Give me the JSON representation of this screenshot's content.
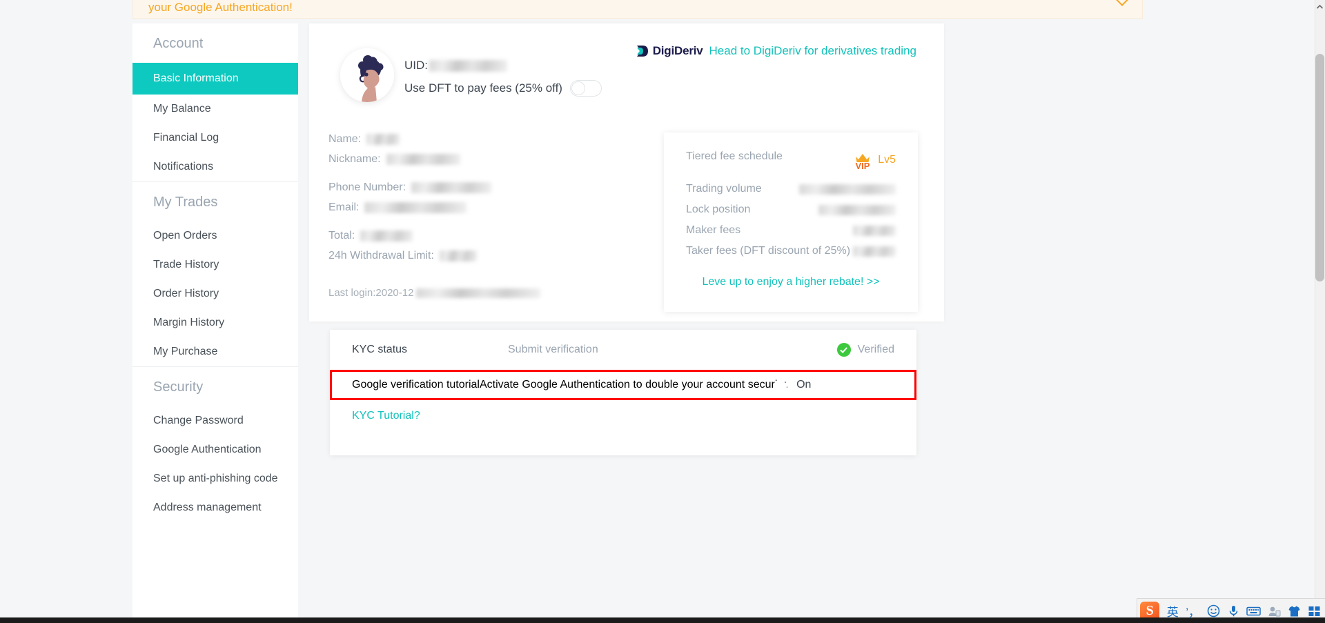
{
  "banner": {
    "text": "your Google Authentication!",
    "chevron_icon": "chevron-down-icon"
  },
  "sidebar": {
    "groups": [
      {
        "title": "Account",
        "items": [
          {
            "label": "Basic Information",
            "active": true
          },
          {
            "label": "My Balance",
            "active": false
          },
          {
            "label": "Financial Log",
            "active": false
          },
          {
            "label": "Notifications",
            "active": false
          }
        ]
      },
      {
        "title": "My Trades",
        "items": [
          {
            "label": "Open Orders",
            "active": false
          },
          {
            "label": "Trade History",
            "active": false
          },
          {
            "label": "Order History",
            "active": false
          },
          {
            "label": "Margin History",
            "active": false
          },
          {
            "label": "My Purchase",
            "active": false
          }
        ]
      },
      {
        "title": "Security",
        "items": [
          {
            "label": "Change Password",
            "active": false
          },
          {
            "label": "Google Authentication",
            "active": false
          },
          {
            "label": "Set up anti-phishing code",
            "active": false
          },
          {
            "label": "Address management",
            "active": false
          }
        ]
      }
    ]
  },
  "profile": {
    "avatar_icon": "user-avatar",
    "uid_label": "UID:",
    "uid_value_redacted": true,
    "dft_label": "Use DFT to pay fees (25% off)",
    "dft_toggle_state": "off",
    "fields": [
      {
        "label": "Name:",
        "redacted": true,
        "blur_width": 48
      },
      {
        "label": "Nickname:",
        "redacted": true,
        "blur_width": 107
      },
      {
        "label": "Phone Number:",
        "redacted": true,
        "blur_width": 116
      },
      {
        "label": "Email:",
        "redacted": true,
        "blur_width": 148
      },
      {
        "label": "Total:",
        "redacted": true,
        "blur_width": 76
      },
      {
        "label": "24h Withdrawal Limit:",
        "redacted": true,
        "blur_width": 54
      }
    ],
    "last_login_label": "Last login:2020-12",
    "last_login_redacted": true
  },
  "deriv_banner": {
    "logo_text": "DigiDeriv",
    "cta_text": "Head to DigiDeriv for derivatives trading",
    "accent": "#12c2bb",
    "logo_color": "#1b1b4b"
  },
  "fee_card": {
    "title": "Tiered fee schedule",
    "vip_icon": "crown-icon",
    "vip_word": "VIP",
    "level": "Lv5",
    "level_color": "#f5a623",
    "rows": [
      {
        "label": "Trading volume",
        "redacted": true,
        "blur_width": 140
      },
      {
        "label": "Lock position",
        "redacted": true,
        "blur_width": 112
      },
      {
        "label": "Maker fees",
        "redacted": true,
        "blur_width": 62
      },
      {
        "label": "Taker fees (DFT discount of 25%)",
        "redacted": true,
        "blur_width": 62
      }
    ],
    "link_text": "Leve up to enjoy a higher rebate! >>"
  },
  "kyc_card": {
    "rows": [
      {
        "name": "KYC status",
        "action": "Submit verification",
        "status_icon": "check-circle-icon",
        "status_text": "Verified",
        "status_color": "#3dc93d",
        "highlighted": false
      },
      {
        "name": "Google verification tutorial",
        "action": "Activate Google Authentication to double your account security.",
        "toggle_state": "on",
        "status_text": "On",
        "highlighted": true,
        "highlight_color": "#ff0000"
      }
    ],
    "tutorial_link": "KYC Tutorial?"
  },
  "ime_bar": {
    "logo_text": "S",
    "items": [
      {
        "icon": "chinese-english-toggle-icon",
        "glyph": "英"
      },
      {
        "icon": "punctuation-icon",
        "glyph": "’，"
      },
      {
        "icon": "emoji-icon",
        "glyph": "☺"
      },
      {
        "icon": "microphone-icon",
        "glyph": "🎤"
      },
      {
        "icon": "soft-keyboard-icon",
        "glyph": "⌨"
      },
      {
        "icon": "user-account-icon",
        "glyph": "👤"
      },
      {
        "icon": "skin-shirt-icon",
        "glyph": "👕"
      },
      {
        "icon": "toolbox-grid-icon",
        "glyph": "▦"
      }
    ]
  },
  "scrollbar": {
    "up_arrow_icon": "scroll-up-arrow-icon",
    "down_arrow_icon": "scroll-down-arrow-icon"
  }
}
